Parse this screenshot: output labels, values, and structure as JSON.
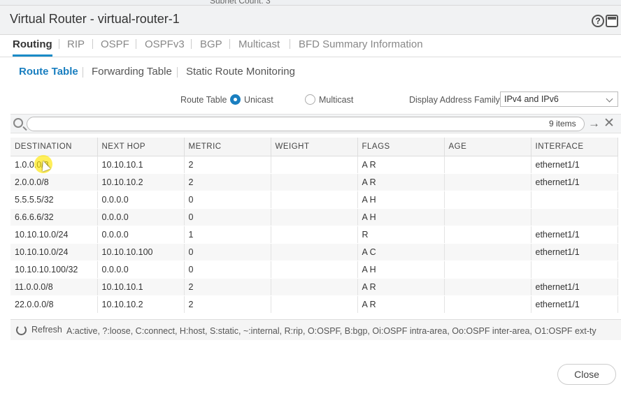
{
  "background": {
    "subnet_text": "Subnet Count: 3"
  },
  "window": {
    "title": "Virtual Router - virtual-router-1"
  },
  "tabs": [
    "Routing",
    "RIP",
    "OSPF",
    "OSPFv3",
    "BGP",
    "Multicast",
    "BFD Summary Information"
  ],
  "subtabs": [
    "Route Table",
    "Forwarding Table",
    "Static Route Monitoring"
  ],
  "options": {
    "route_table_label": "Route Table",
    "unicast": "Unicast",
    "multicast": "Multicast",
    "family_label": "Display Address Family",
    "family_value": "IPv4 and IPv6"
  },
  "search": {
    "placeholder": "",
    "items_count": "9 items"
  },
  "table": {
    "headers": [
      "DESTINATION",
      "NEXT HOP",
      "METRIC",
      "WEIGHT",
      "FLAGS",
      "AGE",
      "INTERFACE"
    ],
    "rows": [
      [
        "1.0.0.0/8",
        "10.10.10.1",
        "2",
        "",
        "A R",
        "",
        "ethernet1/1"
      ],
      [
        "2.0.0.0/8",
        "10.10.10.2",
        "2",
        "",
        "A R",
        "",
        "ethernet1/1"
      ],
      [
        "5.5.5.5/32",
        "0.0.0.0",
        "0",
        "",
        "A H",
        "",
        ""
      ],
      [
        "6.6.6.6/32",
        "0.0.0.0",
        "0",
        "",
        "A H",
        "",
        ""
      ],
      [
        "10.10.10.0/24",
        "0.0.0.0",
        "1",
        "",
        "R",
        "",
        "ethernet1/1"
      ],
      [
        "10.10.10.0/24",
        "10.10.10.100",
        "0",
        "",
        "A C",
        "",
        "ethernet1/1"
      ],
      [
        "10.10.10.100/32",
        "0.0.0.0",
        "0",
        "",
        "A H",
        "",
        ""
      ],
      [
        "11.0.0.0/8",
        "10.10.10.1",
        "2",
        "",
        "A R",
        "",
        "ethernet1/1"
      ],
      [
        "22.0.0.0/8",
        "10.10.10.2",
        "2",
        "",
        "A R",
        "",
        "ethernet1/1"
      ]
    ]
  },
  "footer": {
    "refresh": "Refresh",
    "legend": "A:active, ?:loose, C:connect, H:host, S:static, ~:internal, R:rip, O:OSPF, B:bgp, Oi:OSPF intra-area, Oo:OSPF inter-area, O1:OSPF ext-ty"
  },
  "buttons": {
    "close": "Close"
  },
  "colors": {
    "accent": "#1a7fc0",
    "tab_underline": "#1a8bc7",
    "highlight": "#ffe600"
  }
}
